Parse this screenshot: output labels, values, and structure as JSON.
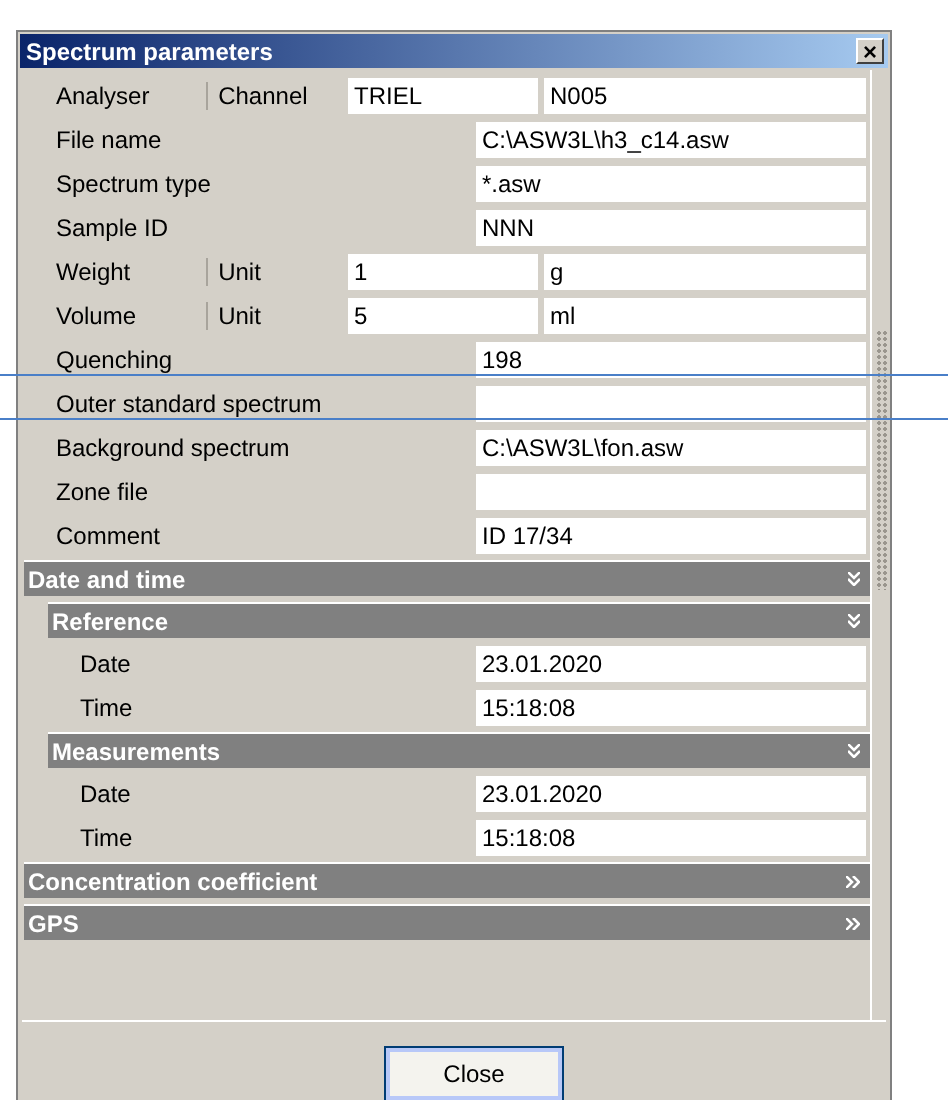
{
  "window": {
    "title": "Spectrum parameters",
    "close_symbol": "×"
  },
  "rows": [
    {
      "label": "Analyser",
      "sublabel": "Channel",
      "values": [
        "TRIEL",
        "N005"
      ]
    },
    {
      "label": "File name",
      "values": [
        "C:\\ASW3L\\h3_c14.asw"
      ]
    },
    {
      "label": "Spectrum type",
      "values": [
        "*.asw"
      ]
    },
    {
      "label": "Sample ID",
      "values": [
        "NNN"
      ]
    },
    {
      "label": "Weight",
      "sublabel": "Unit",
      "values": [
        "1",
        "g"
      ]
    },
    {
      "label": "Volume",
      "sublabel": "Unit",
      "values": [
        "5",
        "ml"
      ]
    },
    {
      "label": "Quenching",
      "values": [
        "198"
      ]
    },
    {
      "label": "Outer standard spectrum"
    },
    {
      "label": "Background spectrum",
      "values": [
        "C:\\ASW3L\\fon.asw"
      ]
    },
    {
      "label": "Zone file"
    },
    {
      "label": "Comment",
      "values": [
        "ID 17/34"
      ]
    }
  ],
  "sections": [
    {
      "title": "Date and time",
      "expanded": true,
      "children": [
        {
          "title": "Reference",
          "expanded": true,
          "rows": [
            {
              "label": "Date",
              "values": [
                "23.01.2020"
              ]
            },
            {
              "label": "Time",
              "values": [
                "15:18:08"
              ]
            }
          ]
        },
        {
          "title": "Measurements",
          "expanded": true,
          "rows": [
            {
              "label": "Date",
              "values": [
                "23.01.2020"
              ]
            },
            {
              "label": "Time",
              "values": [
                "15:18:08"
              ]
            }
          ]
        }
      ]
    },
    {
      "title": "Concentration coefficient",
      "expanded": false
    },
    {
      "title": "GPS",
      "expanded": false
    }
  ],
  "footer": {
    "button": "Close"
  }
}
